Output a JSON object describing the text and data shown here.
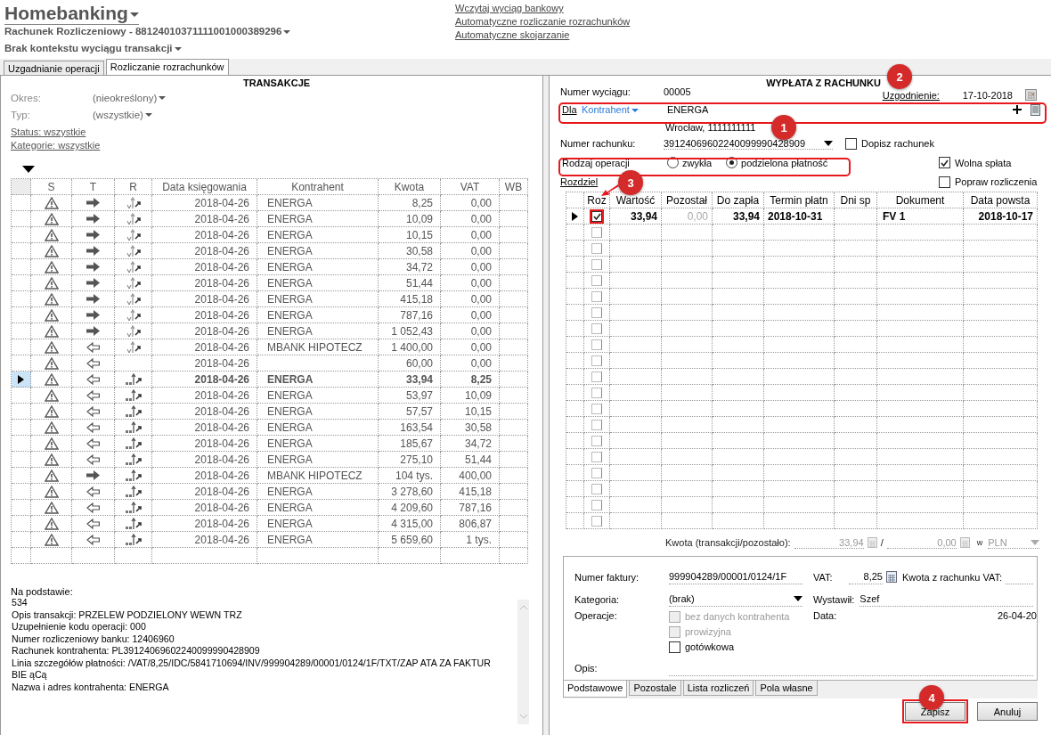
{
  "header": {
    "title": "Homebanking",
    "account": "Rachunek Rozliczeniowy - 88124010371111001000389296",
    "context": "Brak kontekstu wyciągu transakcji",
    "links": [
      "Wczytaj wyciąg bankowy",
      "Automatyczne rozliczanie rozrachunków",
      "Automatyczne skojarzanie"
    ]
  },
  "tabs": [
    {
      "label": "Uzgadnianie operacji",
      "selected": false
    },
    {
      "label": "Rozliczanie rozrachunków",
      "selected": true
    }
  ],
  "transactions": {
    "title": "TRANSAKCJE",
    "filters": [
      {
        "label": "Okres:",
        "value": "(nieokreślony)"
      },
      {
        "label": "Typ:",
        "value": "(wszystkie)"
      }
    ],
    "links": [
      "Status: wszystkie",
      "Kategorie: wszystkie"
    ],
    "columns": [
      "S",
      "T",
      "R",
      "Data księgowania",
      "Kontrahent",
      "Kwota",
      "VAT",
      "WB"
    ],
    "rows": [
      {
        "outgoing": true,
        "kind": "check",
        "date": "2018-04-26",
        "contractor": "ENERGA",
        "amount": "8,25",
        "vat": "0,00",
        "selected": false
      },
      {
        "outgoing": true,
        "kind": "check",
        "date": "2018-04-26",
        "contractor": "ENERGA",
        "amount": "10,09",
        "vat": "0,00",
        "selected": false
      },
      {
        "outgoing": true,
        "kind": "check",
        "date": "2018-04-26",
        "contractor": "ENERGA",
        "amount": "10,15",
        "vat": "0,00",
        "selected": false
      },
      {
        "outgoing": true,
        "kind": "check",
        "date": "2018-04-26",
        "contractor": "ENERGA",
        "amount": "30,58",
        "vat": "0,00",
        "selected": false
      },
      {
        "outgoing": true,
        "kind": "check",
        "date": "2018-04-26",
        "contractor": "ENERGA",
        "amount": "34,72",
        "vat": "0,00",
        "selected": false
      },
      {
        "outgoing": true,
        "kind": "check",
        "date": "2018-04-26",
        "contractor": "ENERGA",
        "amount": "51,44",
        "vat": "0,00",
        "selected": false
      },
      {
        "outgoing": true,
        "kind": "check",
        "date": "2018-04-26",
        "contractor": "ENERGA",
        "amount": "415,18",
        "vat": "0,00",
        "selected": false
      },
      {
        "outgoing": true,
        "kind": "check",
        "date": "2018-04-26",
        "contractor": "ENERGA",
        "amount": "787,16",
        "vat": "0,00",
        "selected": false
      },
      {
        "outgoing": true,
        "kind": "check",
        "date": "2018-04-26",
        "contractor": "ENERGA",
        "amount": "1 052,43",
        "vat": "0,00",
        "selected": false
      },
      {
        "outgoing": false,
        "kind": "check",
        "date": "2018-04-26",
        "contractor": "MBANK HIPOTECZ",
        "amount": "1 400,00",
        "vat": "0,00",
        "selected": false
      },
      {
        "outgoing": false,
        "kind": "none",
        "date": "2018-04-26",
        "amount": "60,00",
        "vat": "0,00",
        "selected": false
      },
      {
        "outgoing": false,
        "kind": "pp",
        "date": "2018-04-26",
        "contractor": "ENERGA",
        "amount": "33,94",
        "vat": "8,25",
        "selected": true
      },
      {
        "outgoing": false,
        "kind": "pp",
        "date": "2018-04-26",
        "contractor": "ENERGA",
        "amount": "53,97",
        "vat": "10,09",
        "selected": false
      },
      {
        "outgoing": false,
        "kind": "pp",
        "date": "2018-04-26",
        "contractor": "ENERGA",
        "amount": "57,57",
        "vat": "10,15",
        "selected": false
      },
      {
        "outgoing": false,
        "kind": "pp",
        "date": "2018-04-26",
        "contractor": "ENERGA",
        "amount": "163,54",
        "vat": "30,58",
        "selected": false
      },
      {
        "outgoing": false,
        "kind": "pp",
        "date": "2018-04-26",
        "contractor": "ENERGA",
        "amount": "185,67",
        "vat": "34,72",
        "selected": false
      },
      {
        "outgoing": false,
        "kind": "pp",
        "date": "2018-04-26",
        "contractor": "ENERGA",
        "amount": "275,10",
        "vat": "51,44",
        "selected": false
      },
      {
        "outgoing": true,
        "kind": "pp",
        "date": "2018-04-26",
        "contractor": "MBANK HIPOTECZ",
        "amount": "104 tys.",
        "vat": "400,00",
        "selected": false
      },
      {
        "outgoing": false,
        "kind": "pp",
        "date": "2018-04-26",
        "contractor": "ENERGA",
        "amount": "3 278,60",
        "vat": "415,18",
        "selected": false
      },
      {
        "outgoing": false,
        "kind": "pp",
        "date": "2018-04-26",
        "contractor": "ENERGA",
        "amount": "4 209,60",
        "vat": "787,16",
        "selected": false
      },
      {
        "outgoing": false,
        "kind": "pp",
        "date": "2018-04-26",
        "contractor": "ENERGA",
        "amount": "4 315,00",
        "vat": "806,87",
        "selected": false
      },
      {
        "outgoing": false,
        "kind": "pp",
        "date": "2018-04-26",
        "contractor": "ENERGA",
        "amount": "5 659,60",
        "vat": "1 tys.",
        "selected": false
      }
    ],
    "details_label": "Na podstawie:",
    "details": [
      "534",
      "Opis transakcji: PRZELEW PODZIELONY WEWN TRZ",
      "Uzupełnienie kodu operacji: 000",
      "Numer rozliczeniowy banku: 12406960",
      "Rachunek kontrahenta: PL39124069602240099990428909",
      "Linia szczegółów płatności: /VAT/8,25/IDC/5841710694/INV/999904289/00001/0124/1F/TXT/ZAP ATA ZA FAKTUR",
      "BIE ąCą",
      "Nazwa i adres kontrahenta: ENERGA"
    ]
  },
  "payment": {
    "title": "WYPŁATA Z RACHUNKU",
    "statement_label": "Numer wyciągu:",
    "statement": "00005",
    "reconcile_label": "Uzgodnienie:",
    "reconcile_date": "17-10-2018",
    "for_label": "Dla",
    "for_type": "Kontrahent",
    "for_name": "ENERGA",
    "address": "Wrocław, 1111111111",
    "account_label": "Numer rachunku:",
    "account": "39124069602240099990428909",
    "checkboxes": [
      {
        "label": "Dopisz rachunek",
        "checked": false
      },
      {
        "label": "Wolna spłata",
        "checked": true
      },
      {
        "label": "Popraw rozliczenia",
        "checked": false
      }
    ],
    "operation_label": "Rodzaj operacji",
    "operation_types": [
      {
        "label": "zwykła",
        "selected": false
      },
      {
        "label": "podzielona płatność",
        "selected": true
      }
    ],
    "split_link": "Rozdziel",
    "columns": [
      "Roz",
      "Wartość",
      "Pozostał",
      "Do zapła",
      "Termin płatn",
      "Dni sp",
      "Dokument",
      "Data powsta"
    ],
    "rows": [
      {
        "current": true,
        "checked": true,
        "cells": [
          "33,94",
          "0,00",
          "33,94",
          "2018-10-31",
          "",
          "FV 1",
          "2018-10-17"
        ]
      },
      {
        "current": false,
        "checked": false
      },
      {
        "current": false,
        "checked": false
      },
      {
        "current": false,
        "checked": false
      },
      {
        "current": false,
        "checked": false
      },
      {
        "current": false,
        "checked": false
      },
      {
        "current": false,
        "checked": false
      },
      {
        "current": false,
        "checked": false
      },
      {
        "current": false,
        "checked": false
      },
      {
        "current": false,
        "checked": false
      },
      {
        "current": false,
        "checked": false
      },
      {
        "current": false,
        "checked": false
      },
      {
        "current": false,
        "checked": false
      },
      {
        "current": false,
        "checked": false
      },
      {
        "current": false,
        "checked": false
      },
      {
        "current": false,
        "checked": false
      },
      {
        "current": false,
        "checked": false
      },
      {
        "current": false,
        "checked": false
      },
      {
        "current": false,
        "checked": false
      },
      {
        "current": false,
        "checked": false
      }
    ],
    "amount_label": "Kwota (transakcji/pozostało):",
    "amount": "33,94",
    "separator": "/",
    "remaining": "0,00",
    "currency_label": "w",
    "currency": "PLN",
    "invoice_label": "Numer faktury:",
    "invoice": "999904289/00001/0124/1F",
    "vat_label": "VAT:",
    "vat": "8,25",
    "vat_account_label": "Kwota z rachunku VAT:",
    "category_label": "Kategoria:",
    "category": "(brak)",
    "issuer_label": "Wystawił:",
    "issuer": "Szef",
    "operations_label": "Operacje:",
    "operations": [
      {
        "label": "bez danych kontrahenta",
        "checked": false,
        "disabled": true
      },
      {
        "label": "prowizyjna",
        "checked": false,
        "disabled": true
      },
      {
        "label": "gotówkowa",
        "checked": false,
        "disabled": false
      }
    ],
    "date_label": "Data:",
    "date": "26-04-20",
    "description_label": "Opis:",
    "tabs": [
      {
        "label": "Podstawowe",
        "selected": true
      },
      {
        "label": "Pozostale",
        "selected": false
      },
      {
        "label": "Lista rozliczeń",
        "selected": false
      },
      {
        "label": "Pola własne",
        "selected": false
      }
    ],
    "buttons": [
      "Zapisz",
      "Anuluj"
    ]
  },
  "annotations": [
    {
      "number": "1"
    },
    {
      "number": "2"
    },
    {
      "number": "3"
    },
    {
      "number": "4"
    }
  ]
}
